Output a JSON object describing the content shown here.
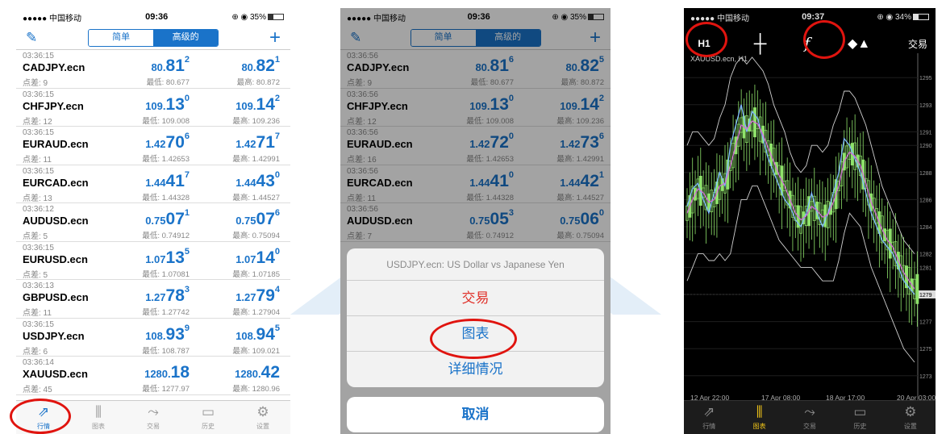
{
  "status": {
    "carrier": "●●●●● 中国移动",
    "wifi": "wifi-icon",
    "time": "09:36",
    "time3": "09:37",
    "battery": "35%",
    "battery3": "34%"
  },
  "quotes_nav": {
    "seg_simple": "简单",
    "seg_advanced": "高级的"
  },
  "rows_p1": [
    {
      "time": "03:36:15",
      "symbol": "CADJPY.ecn",
      "spread": "点差: 9",
      "bid_a": "80.",
      "bid_b": "81",
      "bid_c": "2",
      "ask_a": "80.",
      "ask_b": "82",
      "ask_c": "1",
      "low": "最低: 80.677",
      "high": "最高: 80.872"
    },
    {
      "time": "03:36:15",
      "symbol": "CHFJPY.ecn",
      "spread": "点差: 12",
      "bid_a": "109.",
      "bid_b": "13",
      "bid_c": "0",
      "ask_a": "109.",
      "ask_b": "14",
      "ask_c": "2",
      "low": "最低: 109.008",
      "high": "最高: 109.236"
    },
    {
      "time": "03:36:15",
      "symbol": "EURAUD.ecn",
      "spread": "点差: 11",
      "bid_a": "1.42",
      "bid_b": "70",
      "bid_c": "6",
      "ask_a": "1.42",
      "ask_b": "71",
      "ask_c": "7",
      "low": "最低: 1.42653",
      "high": "最高: 1.42991"
    },
    {
      "time": "03:36:15",
      "symbol": "EURCAD.ecn",
      "spread": "点差: 13",
      "bid_a": "1.44",
      "bid_b": "41",
      "bid_c": "7",
      "ask_a": "1.44",
      "ask_b": "43",
      "ask_c": "0",
      "low": "最低: 1.44328",
      "high": "最高: 1.44527"
    },
    {
      "time": "03:36:12",
      "symbol": "AUDUSD.ecn",
      "spread": "点差: 5",
      "bid_a": "0.75",
      "bid_b": "07",
      "bid_c": "1",
      "ask_a": "0.75",
      "ask_b": "07",
      "ask_c": "6",
      "low": "最低: 0.74912",
      "high": "最高: 0.75094"
    },
    {
      "time": "03:36:15",
      "symbol": "EURUSD.ecn",
      "spread": "点差: 5",
      "bid_a": "1.07",
      "bid_b": "13",
      "bid_c": "5",
      "ask_a": "1.07",
      "ask_b": "14",
      "ask_c": "0",
      "low": "最低: 1.07081",
      "high": "最高: 1.07185"
    },
    {
      "time": "03:36:13",
      "symbol": "GBPUSD.ecn",
      "spread": "点差: 11",
      "bid_a": "1.27",
      "bid_b": "78",
      "bid_c": "3",
      "ask_a": "1.27",
      "ask_b": "79",
      "ask_c": "4",
      "low": "最低: 1.27742",
      "high": "最高: 1.27904"
    },
    {
      "time": "03:36:15",
      "symbol": "USDJPY.ecn",
      "spread": "点差: 6",
      "bid_a": "108.",
      "bid_b": "93",
      "bid_c": "9",
      "ask_a": "108.",
      "ask_b": "94",
      "ask_c": "5",
      "low": "最低: 108.787",
      "high": "最高: 109.021"
    },
    {
      "time": "03:36:14",
      "symbol": "XAUUSD.ecn",
      "spread": "点差: 45",
      "bid_a": "1280.",
      "bid_b": "18",
      "bid_c": "",
      "ask_a": "1280.",
      "ask_b": "42",
      "ask_c": "",
      "low": "最低: 1277.97",
      "high": "最高: 1280.96"
    }
  ],
  "rows_p2": [
    {
      "time": "03:36:56",
      "symbol": "CADJPY.ecn",
      "spread": "点差: 9",
      "bid_a": "80.",
      "bid_b": "81",
      "bid_c": "6",
      "ask_a": "80.",
      "ask_b": "82",
      "ask_c": "5",
      "low": "最低: 80.677",
      "high": "最高: 80.872"
    },
    {
      "time": "03:36:56",
      "symbol": "CHFJPY.ecn",
      "spread": "点差: 12",
      "bid_a": "109.",
      "bid_b": "13",
      "bid_c": "0",
      "ask_a": "109.",
      "ask_b": "14",
      "ask_c": "2",
      "low": "最低: 109.008",
      "high": "最高: 109.236"
    },
    {
      "time": "03:36:56",
      "symbol": "EURAUD.ecn",
      "spread": "点差: 16",
      "bid_a": "1.42",
      "bid_b": "72",
      "bid_c": "0",
      "ask_a": "1.42",
      "ask_b": "73",
      "ask_c": "6",
      "low": "最低: 1.42653",
      "high": "最高: 1.42991"
    },
    {
      "time": "03:36:56",
      "symbol": "EURCAD.ecn",
      "spread": "点差: 11",
      "bid_a": "1.44",
      "bid_b": "41",
      "bid_c": "0",
      "ask_a": "1.44",
      "ask_b": "42",
      "ask_c": "1",
      "low": "最低: 1.44328",
      "high": "最高: 1.44527"
    },
    {
      "time": "03:36:56",
      "symbol": "AUDUSD.ecn",
      "spread": "点差: 7",
      "bid_a": "0.75",
      "bid_b": "05",
      "bid_c": "3",
      "ask_a": "0.75",
      "ask_b": "06",
      "ask_c": "0",
      "low": "最低: 0.74912",
      "high": "最高: 0.75094"
    }
  ],
  "sheet": {
    "title": "USDJPY.ecn: US Dollar vs Japanese Yen",
    "trade": "交易",
    "chart": "图表",
    "details": "详细情况",
    "cancel": "取消"
  },
  "tabs": [
    {
      "label": "行情",
      "icon": "quotes-icon"
    },
    {
      "label": "图表",
      "icon": "chart-icon"
    },
    {
      "label": "交易",
      "icon": "trade-icon"
    },
    {
      "label": "历史",
      "icon": "history-icon"
    },
    {
      "label": "设置",
      "icon": "settings-icon"
    }
  ],
  "chart_toolbar": {
    "timeframe": "H1",
    "trade": "交易"
  },
  "chart_data": {
    "type": "line",
    "title": "",
    "symbol_label": "XAUUSD.ecn, H1",
    "xlabel": "",
    "ylabel": "",
    "x_ticks": [
      "12 Apr 22:00",
      "17 Apr 08:00",
      "18 Apr 17:00",
      "20 Apr 03:00"
    ],
    "y_ticks": [
      1295,
      1293,
      1291,
      1290,
      1288,
      1286,
      1284,
      1282,
      1281,
      1279,
      1277,
      1275,
      1273
    ],
    "current_price": 1279,
    "ylim": [
      1271.5,
      1296.5
    ],
    "candle_color": "#8fe36b",
    "series": [
      {
        "name": "",
        "values": [
          1285.5,
          1286.8,
          1287.2,
          1286,
          1285,
          1286.5,
          1288,
          1287,
          1290,
          1291.5,
          1293,
          1291,
          1292.5,
          1292,
          1290.5,
          1289,
          1288,
          1287,
          1286,
          1285.5,
          1284.5,
          1284,
          1285,
          1286.5,
          1285,
          1284,
          1285,
          1286.5,
          1288,
          1290.5,
          1290,
          1289,
          1288,
          1286.5,
          1285,
          1284,
          1283,
          1282.5,
          1282,
          1281,
          1280,
          1279.5,
          1279
        ]
      },
      {
        "name": "",
        "values": [
          1285,
          1286,
          1286.8,
          1286.5,
          1285.8,
          1286,
          1287,
          1287.2,
          1288.5,
          1290,
          1291.5,
          1291.2,
          1291.8,
          1291.6,
          1290.8,
          1289.8,
          1288.8,
          1287.8,
          1287,
          1286,
          1285,
          1284.5,
          1284.8,
          1285.5,
          1285.2,
          1284.7,
          1284.9,
          1285.8,
          1287,
          1288.8,
          1289.5,
          1289.2,
          1288.5,
          1287.2,
          1285.8,
          1284.8,
          1283.8,
          1283,
          1282.5,
          1281.5,
          1280.6,
          1280,
          1279.4
        ]
      },
      {
        "name": "",
        "values": [
          1290,
          1291,
          1291,
          1290.5,
          1290,
          1290.5,
          1292,
          1293,
          1295,
          1296,
          1296.5,
          1296,
          1296.5,
          1296,
          1295.5,
          1294.5,
          1293,
          1292,
          1291,
          1289.5,
          1288.5,
          1288,
          1288.5,
          1290,
          1290,
          1289.5,
          1290,
          1291.5,
          1292.5,
          1294,
          1294,
          1293.5,
          1292.5,
          1291.5,
          1290,
          1288.5,
          1287,
          1286,
          1285,
          1284,
          1283,
          1282.5,
          1282
        ]
      },
      {
        "name": "",
        "values": [
          1280,
          1281,
          1282,
          1282,
          1281.5,
          1281.5,
          1282,
          1281.5,
          1282,
          1284,
          1286,
          1286,
          1287,
          1287,
          1286,
          1285,
          1284,
          1283,
          1282.5,
          1282,
          1281.5,
          1281,
          1281,
          1281,
          1280.5,
          1280,
          1280,
          1280,
          1281.5,
          1283.5,
          1285,
          1284.5,
          1284,
          1282.5,
          1281,
          1280,
          1279,
          1278,
          1277,
          1276,
          1275,
          1274.5,
          1274
        ]
      }
    ]
  }
}
